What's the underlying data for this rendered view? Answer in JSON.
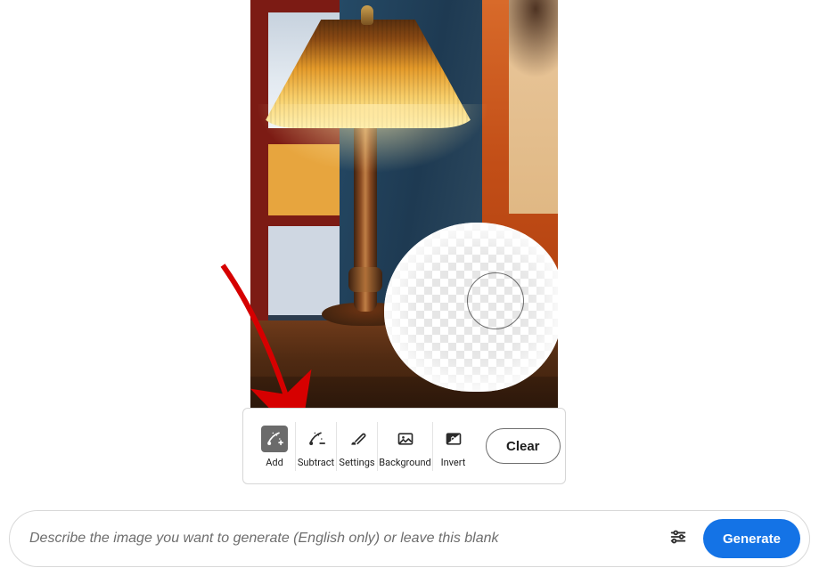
{
  "toolbar": {
    "add_label": "Add",
    "subtract_label": "Subtract",
    "settings_label": "Settings",
    "background_label": "Background",
    "invert_label": "Invert",
    "clear_label": "Clear",
    "active_tool": "add"
  },
  "prompt": {
    "placeholder": "Describe the image you want to generate (English only) or leave this blank",
    "value": "",
    "generate_label": "Generate"
  },
  "annotation": {
    "arrow_target": "subtract-button",
    "arrow_color": "#d60000"
  },
  "colors": {
    "accent": "#1473e6",
    "toolbar_active": "#6b6b6b"
  }
}
